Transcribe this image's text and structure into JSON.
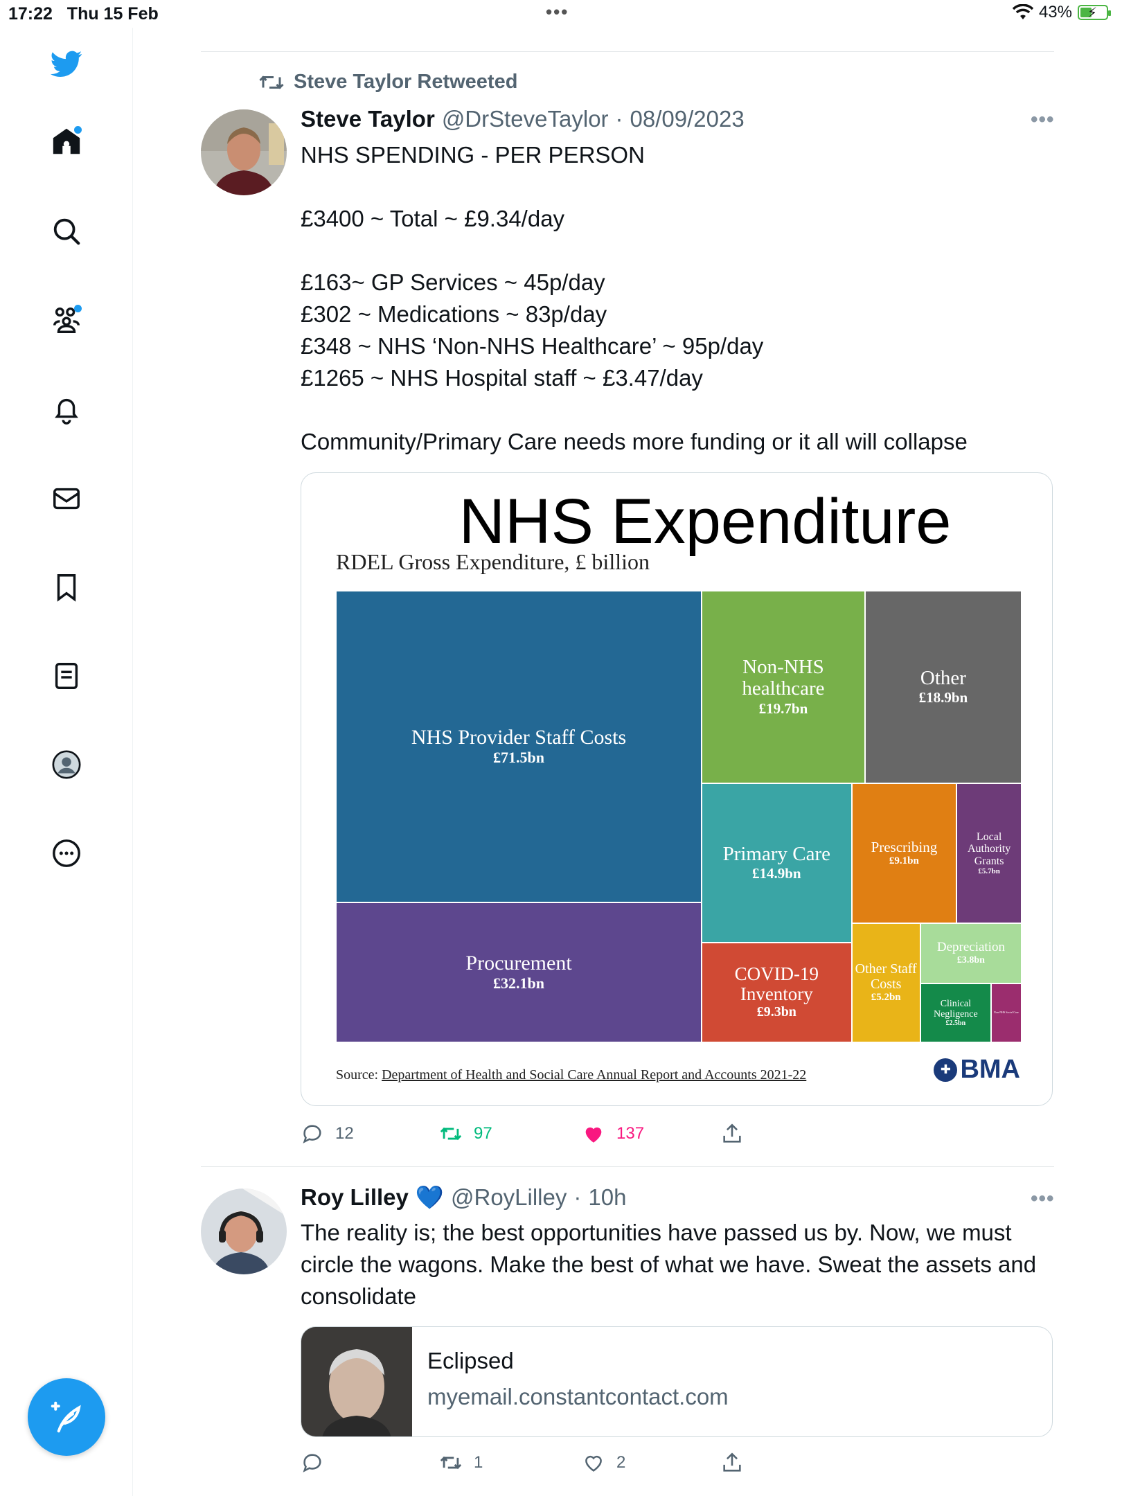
{
  "status_bar": {
    "time": "17:22",
    "date": "Thu 15 Feb",
    "dots": "•••",
    "battery": "43%"
  },
  "sidebar": {
    "items": [
      {
        "icon": "twitter-bird-icon"
      },
      {
        "icon": "home-icon"
      },
      {
        "icon": "search-icon"
      },
      {
        "icon": "communities-icon"
      },
      {
        "icon": "notifications-bell-icon"
      },
      {
        "icon": "messages-envelope-icon"
      },
      {
        "icon": "bookmark-icon"
      },
      {
        "icon": "lists-icon"
      },
      {
        "icon": "profile-avatar-icon"
      },
      {
        "icon": "more-circle-icon"
      }
    ],
    "compose_icon": "compose-feather-icon",
    "accent": "#1d9bf0"
  },
  "tweet1": {
    "retweet_label": "Steve Taylor Retweeted",
    "name": "Steve Taylor",
    "handle": "@DrSteveTaylor",
    "sep": "·",
    "time": "08/09/2023",
    "more": "•••",
    "text": "NHS SPENDING - PER PERSON\n\n£3400 ~ Total ~ £9.34/day\n\n£163~ GP Services ~ 45p/day\n£302 ~ Medications ~ 83p/day\n£348 ~ NHS ‘Non-NHS Healthcare’ ~ 95p/day\n£1265 ~ NHS Hospital staff ~ £3.47/day\n\nCommunity/Primary Care needs more funding or it all will collapse",
    "actions": {
      "replies": "12",
      "retweets": "97",
      "likes": "137"
    }
  },
  "chart_data": {
    "type": "treemap",
    "title": "NHS Expenditure",
    "subtitle": "RDEL Gross Expenditure, £ billion",
    "tiles": [
      {
        "label": "NHS Provider Staff Costs",
        "value_label": "£71.5bn",
        "value": 71.5,
        "color": "#236894"
      },
      {
        "label": "Procurement",
        "value_label": "£32.1bn",
        "value": 32.1,
        "color": "#5d478e"
      },
      {
        "label": "Non-NHS healthcare",
        "value_label": "£19.7bn",
        "value": 19.7,
        "color": "#78b04a"
      },
      {
        "label": "Other",
        "value_label": "£18.9bn",
        "value": 18.9,
        "color": "#676767"
      },
      {
        "label": "Primary Care",
        "value_label": "£14.9bn",
        "value": 14.9,
        "color": "#3aa5a5"
      },
      {
        "label": "Prescribing",
        "value_label": "£9.1bn",
        "value": 9.1,
        "color": "#e07f13"
      },
      {
        "label": "Local Authority Grants",
        "value_label": "£5.7bn",
        "value": 5.7,
        "color": "#6d3b78"
      },
      {
        "label": "COVID-19 Inventory",
        "value_label": "£9.3bn",
        "value": 9.3,
        "color": "#d04a34"
      },
      {
        "label": "Other Staff Costs",
        "value_label": "£5.2bn",
        "value": 5.2,
        "color": "#e9b418"
      },
      {
        "label": "Depreciation",
        "value_label": "£3.8bn",
        "value": 3.8,
        "color": "#a8dc9a"
      },
      {
        "label": "Clinical Negligence",
        "value_label": "£2.5bn",
        "value": 2.5,
        "color": "#148a4a"
      },
      {
        "label": "Non-NHS Social Care",
        "value_label": "",
        "value": null,
        "color": "#9b2d6e"
      }
    ],
    "source_prefix": "Source: ",
    "source_link": "Department of Health and Social Care Annual Report and Accounts 2021-22",
    "logo": "BMA"
  },
  "tweet2": {
    "name": "Roy Lilley",
    "verified_emoji": "💙",
    "handle": "@RoyLilley",
    "sep": "·",
    "time": "10h",
    "more": "•••",
    "text": "The reality is; the best opportunities have passed us by. Now, we must circle the wagons. Make the best of what we have. Sweat the assets and consolidate",
    "link_card": {
      "title": "Eclipsed",
      "domain": "myemail.constantcontact.com"
    },
    "actions": {
      "replies": "",
      "retweets": "1",
      "likes": "2"
    }
  }
}
